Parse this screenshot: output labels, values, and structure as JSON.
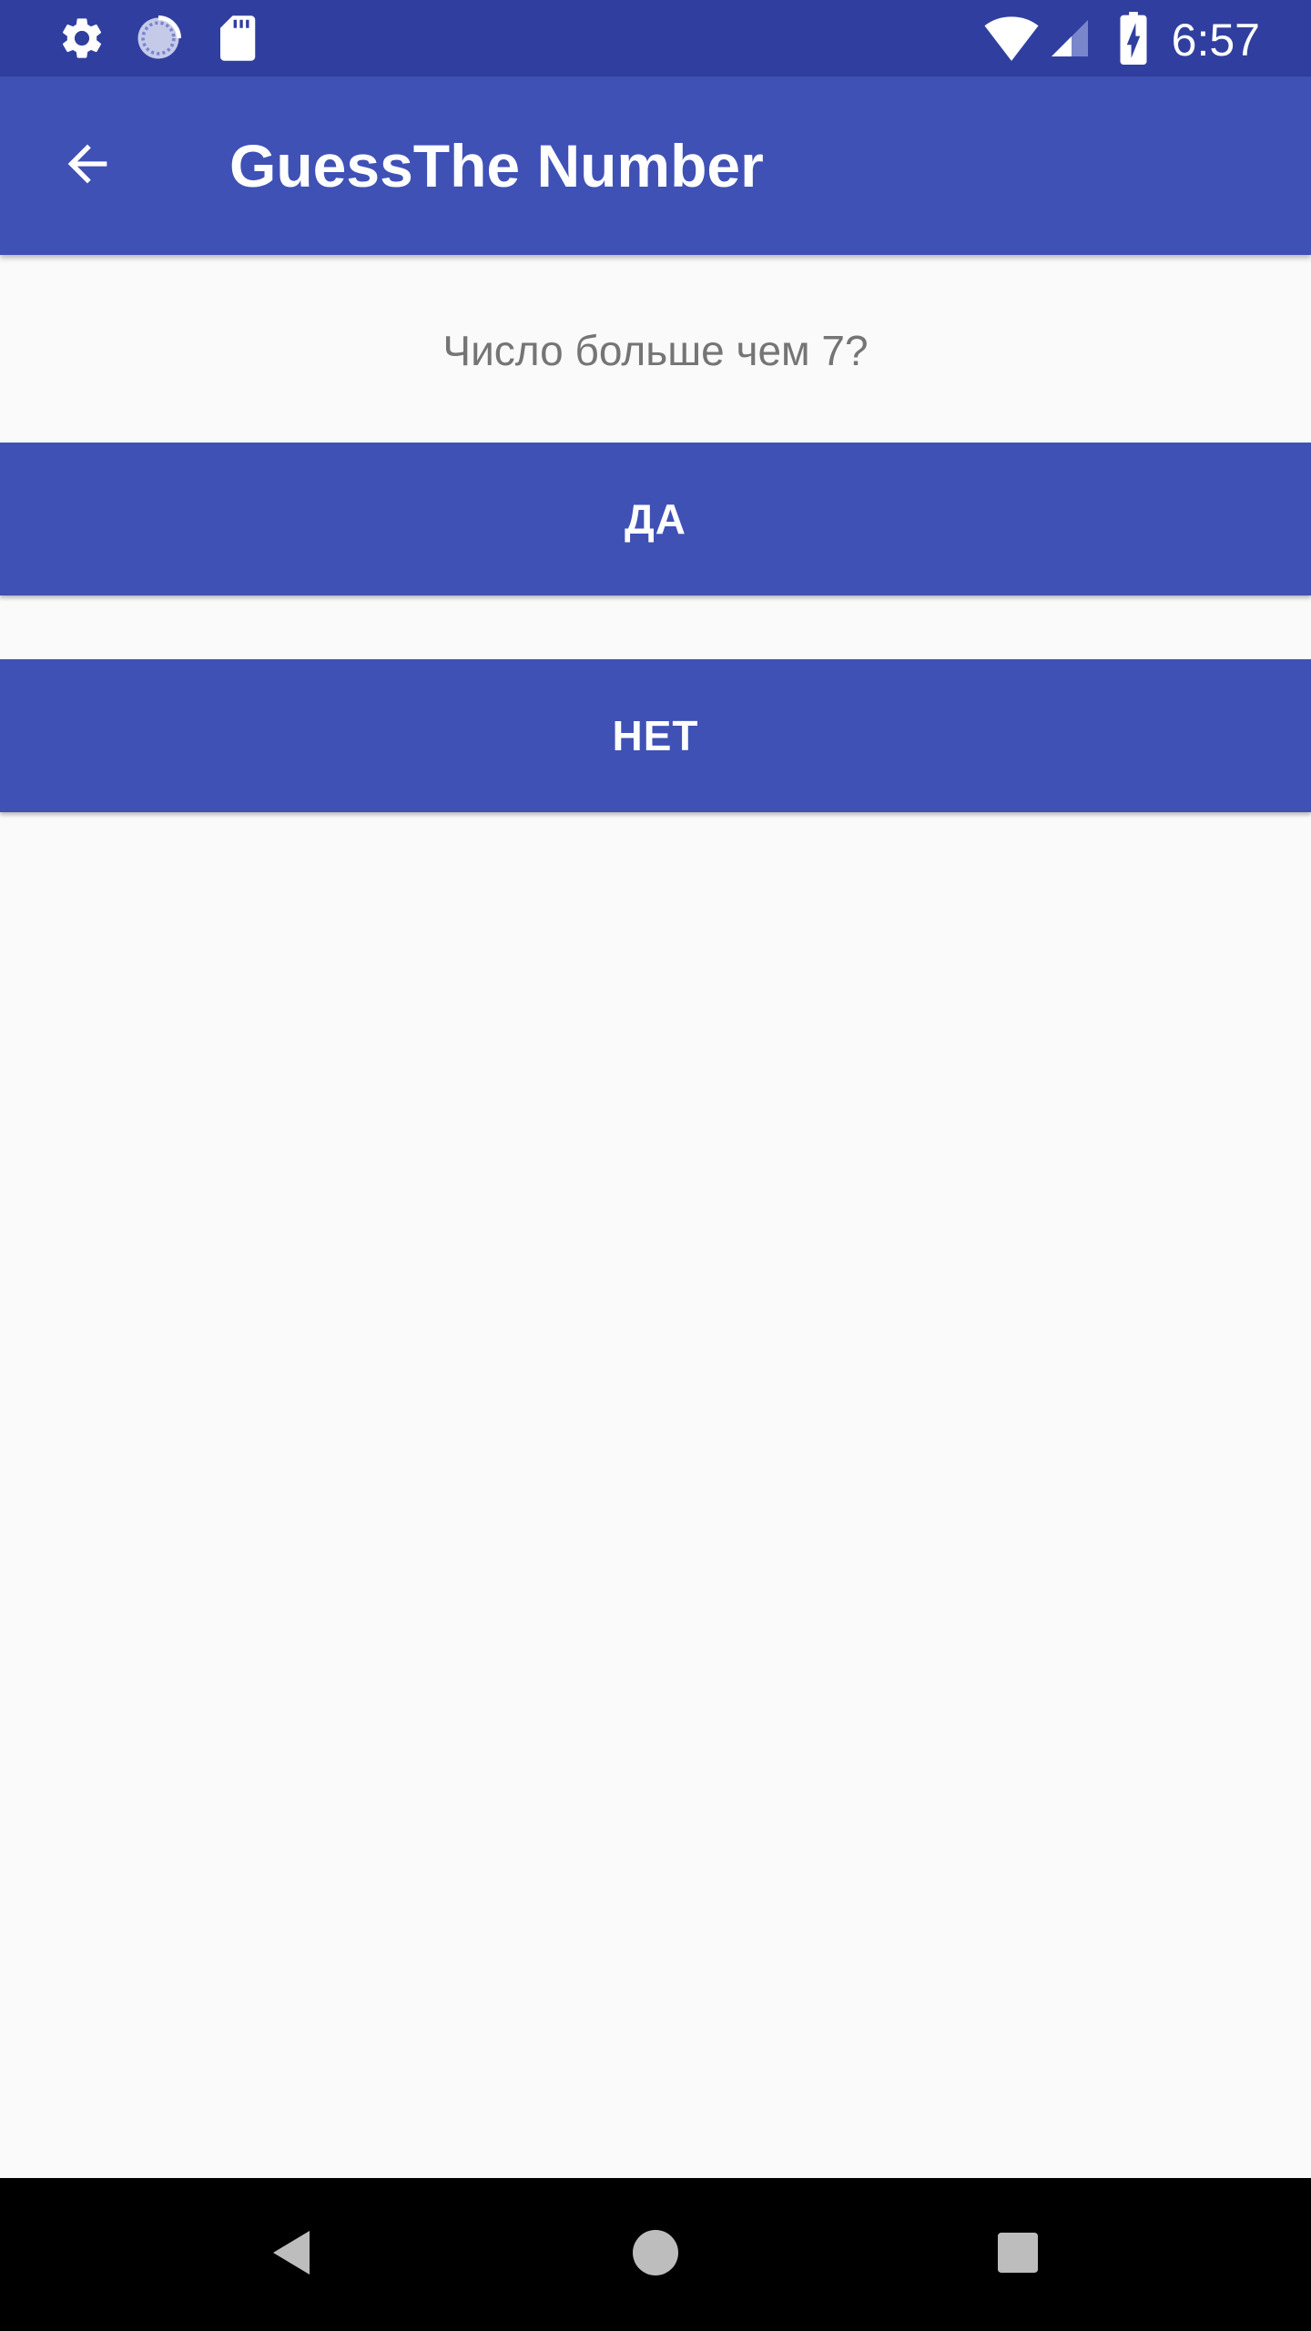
{
  "status_bar": {
    "time": "6:57",
    "left_icons": [
      "settings-icon",
      "sync-icon",
      "sd-card-icon"
    ],
    "right_icons": [
      "wifi-icon",
      "cellular-signal-icon",
      "battery-charging-icon"
    ]
  },
  "app_bar": {
    "back_icon": "arrow-back-icon",
    "title": "GuessThe Number"
  },
  "content": {
    "question": "Число больше чем 7?",
    "yes_label": "ДА",
    "no_label": "НЕТ"
  },
  "nav_bar": {
    "buttons": [
      "back-triangle-icon",
      "home-circle-icon",
      "recents-square-icon"
    ]
  },
  "colors": {
    "status_bar": "#303f9f",
    "primary": "#3f51b5",
    "background": "#fafafa",
    "question_text": "#757575"
  }
}
